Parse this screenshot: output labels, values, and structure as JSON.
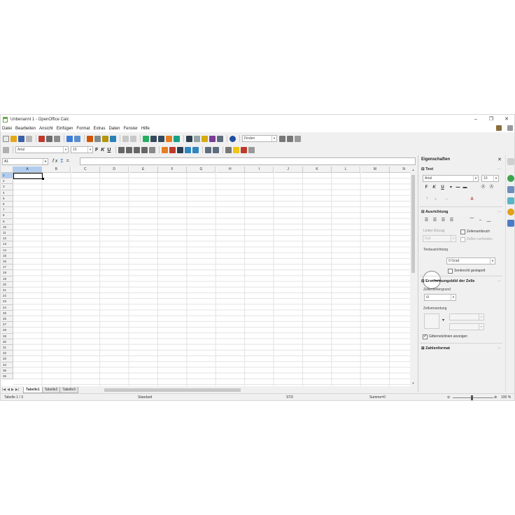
{
  "window": {
    "title": "Unbenannt 1 - OpenOffice Calc",
    "minimize_glyph": "–",
    "maximize_glyph": "❐",
    "close_glyph": "✕"
  },
  "menu": {
    "items": [
      "Datei",
      "Bearbeiten",
      "Ansicht",
      "Einfügen",
      "Format",
      "Extras",
      "Daten",
      "Fenster",
      "Hilfe"
    ]
  },
  "toolbar_std": {
    "find_placeholder": "Finden"
  },
  "toolbar_fmt": {
    "font_name": "Arial",
    "font_size": "10",
    "bold_label": "F",
    "italic_label": "K",
    "underline_label": "U"
  },
  "formula_bar": {
    "cell_ref": "A1",
    "fx_label": "f x",
    "sum_label": "Σ",
    "equals_label": "="
  },
  "grid": {
    "columns": [
      "A",
      "B",
      "C",
      "D",
      "E",
      "F",
      "G",
      "H",
      "I",
      "J",
      "K",
      "L",
      "M",
      "N"
    ],
    "row_count": 36,
    "active_column": "A",
    "active_row": 1
  },
  "sheet_tabs": {
    "tabs": [
      "Tabelle1",
      "Tabelle2",
      "Tabelle3"
    ],
    "active": "Tabelle1"
  },
  "status_bar": {
    "sheet_info": "Tabelle 1 / 3",
    "page_style": "Standard",
    "mode": "STD",
    "sum": "Summe=0",
    "zoom": "100 %"
  },
  "sidebar": {
    "title": "Eigenschaften",
    "text_section": {
      "title": "Text",
      "font_name": "Arial",
      "font_size": "10",
      "bold": "F",
      "italic": "K",
      "underline": "U"
    },
    "alignment_section": {
      "title": "Ausrichtung",
      "left_indent_label": "Linker Einzug",
      "left_indent_value": "0 pt",
      "wrap_label": "Zeilenumbruch",
      "merge_label": "Zellen verbinden",
      "orientation_label": "Textausrichtung",
      "rotation_value": "0 Grad",
      "stacked_label": "Senkrecht gestapelt"
    },
    "cell_appearance_section": {
      "title": "Erscheinungsbild der Zelle",
      "background_label": "Zellenhintergrund",
      "border_label": "Zellumrandung",
      "gridlines_label": "Gitternetzlinien anzeigen"
    },
    "number_format_section": {
      "title": "Zahlenformat"
    }
  },
  "colors": {
    "accent": "#b0cdf0",
    "grid_line": "#e2e2e2",
    "header_bg": "#f2f2f2"
  }
}
